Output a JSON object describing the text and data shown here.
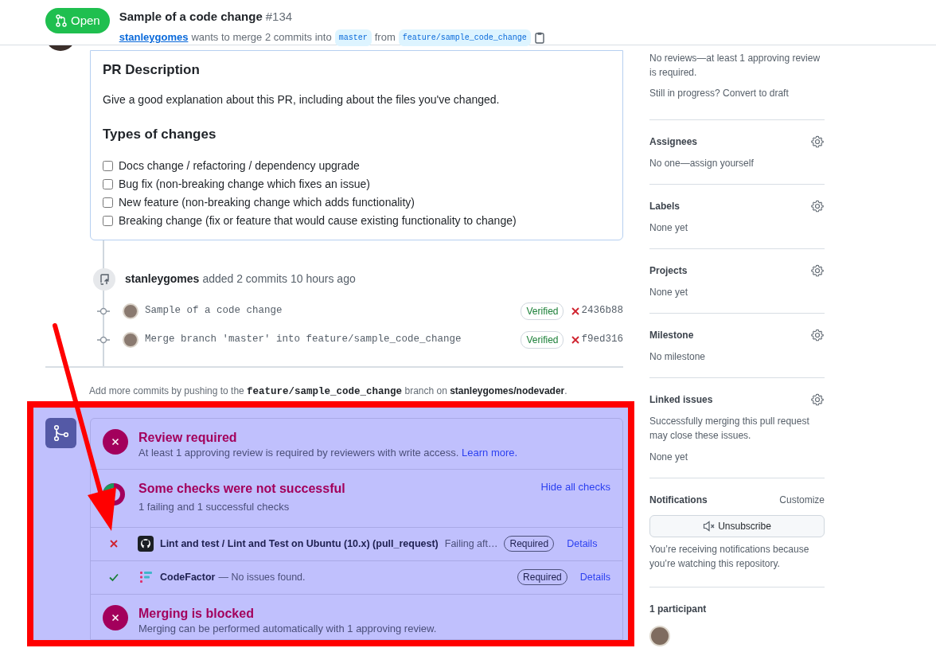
{
  "header": {
    "state": "Open",
    "title": "Sample of a code change",
    "number": "#134",
    "author": "stanleygomes",
    "summary": "wants to merge 2 commits into",
    "base_branch": "master",
    "from": "from",
    "head_branch": "feature/sample_code_change"
  },
  "description": {
    "heading": "PR Description",
    "text": "Give a good explanation about this PR, including about the files you've changed.",
    "changes_heading": "Types of changes",
    "checklist": [
      {
        "label": "Docs change / refactoring / dependency upgrade",
        "checked": false
      },
      {
        "label": "Bug fix (non-breaking change which fixes an issue)",
        "checked": false
      },
      {
        "label": "New feature (non-breaking change which adds functionality)",
        "checked": false
      },
      {
        "label": "Breaking change (fix or feature that would cause existing functionality to change)",
        "checked": false
      }
    ]
  },
  "commit_event": {
    "actor": "stanleygomes",
    "text": "added 2 commits",
    "time": "10 hours ago",
    "commits": [
      {
        "message": "Sample of a code change",
        "badge": "Verified",
        "failed": true,
        "sha": "2436b88"
      },
      {
        "message": "Merge branch 'master' into feature/sample_code_change",
        "badge": "Verified",
        "failed": true,
        "sha": "f9ed316"
      }
    ]
  },
  "push_hint": {
    "before": "Add more commits by pushing to the",
    "branch": "feature/sample_code_change",
    "middle": "branch on",
    "repo": "stanleygomes/nodevader",
    "after": "."
  },
  "merge_box": {
    "sections": [
      {
        "kind": "status",
        "passed": false,
        "title": "Review required",
        "text": "At least 1 approving review is required by reviewers with write access.",
        "link": "Learn more."
      },
      {
        "kind": "checks_summary",
        "title": "Some checks were not successful",
        "text": "1 failing and 1 successful checks",
        "toggle": "Hide all checks",
        "checks": [
          {
            "kind": "github",
            "passed": false,
            "name": "Lint and test / Lint and Test on Ubuntu (10.x) (pull_request)",
            "description": "Failing aft…",
            "required": "Required",
            "details": "Details"
          },
          {
            "kind": "codefactor",
            "passed": true,
            "name": "CodeFactor",
            "description": "— No issues found.",
            "required": "Required",
            "details": "Details"
          }
        ]
      },
      {
        "kind": "status",
        "passed": false,
        "title": "Merging is blocked",
        "text": "Merging can be performed automatically with 1 approving review."
      }
    ]
  },
  "sidebar": {
    "reviewers": {
      "text": "No reviews—at least 1 approving review is required.",
      "draft": "Still in progress? Convert to draft"
    },
    "sections": [
      {
        "kind": "setting",
        "heading": "Assignees",
        "texts": [
          "No one—assign yourself"
        ]
      },
      {
        "kind": "setting",
        "heading": "Labels",
        "texts": [
          "None yet"
        ]
      },
      {
        "kind": "setting",
        "heading": "Projects",
        "texts": [
          "None yet"
        ]
      },
      {
        "kind": "setting",
        "heading": "Milestone",
        "texts": [
          "No milestone"
        ]
      },
      {
        "kind": "setting",
        "heading": "Linked issues",
        "texts": [
          "Successfully merging this pull request may close these issues.",
          "None yet"
        ]
      },
      {
        "kind": "notifications",
        "heading": "Notifications",
        "action": "Customize",
        "button": "Unsubscribe",
        "texts": [
          "You’re receiving notifications because you’re watching this repository."
        ]
      },
      {
        "kind": "participants",
        "heading": "1 participant",
        "participants": [
          {
            "kind": "avatar"
          }
        ]
      }
    ]
  },
  "annotations": {
    "frame": true,
    "arrow": true
  }
}
